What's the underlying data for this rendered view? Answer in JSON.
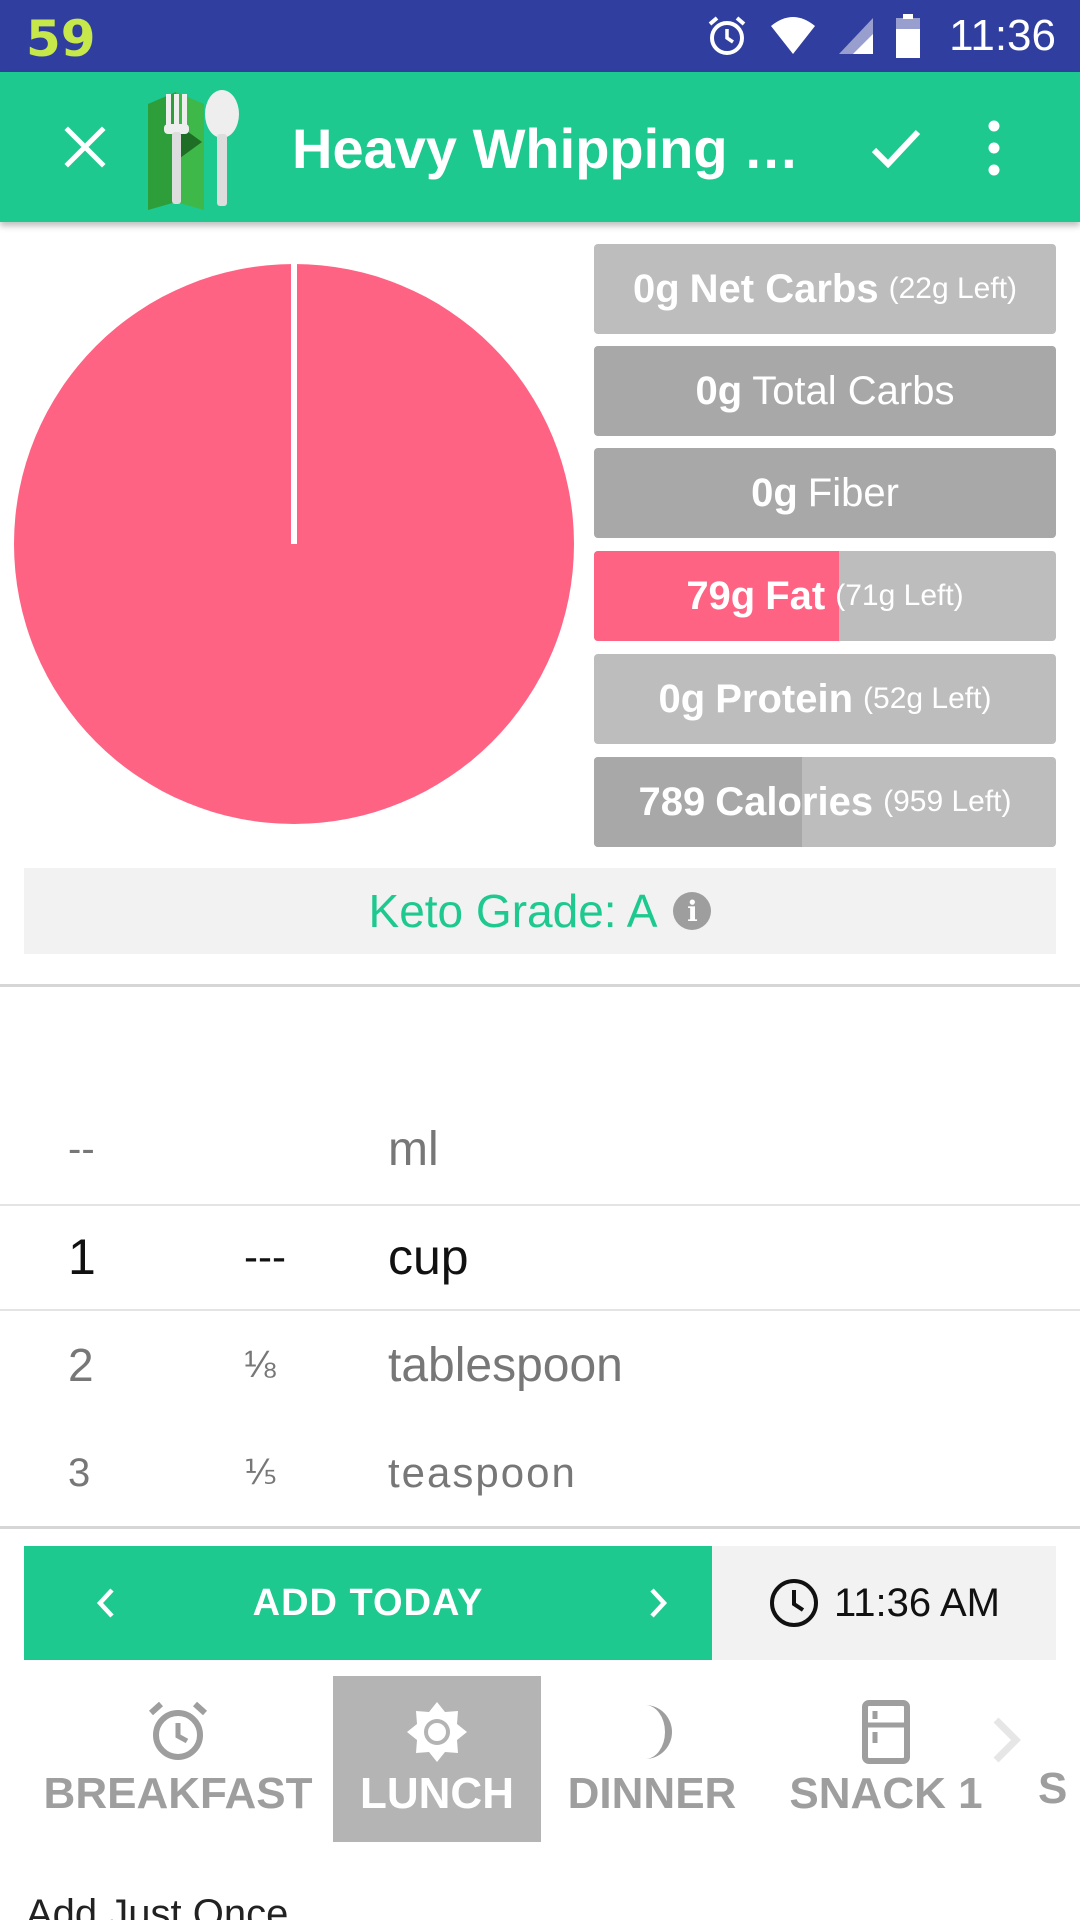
{
  "status_bar": {
    "notification_number": "59",
    "time": "11:36",
    "icons": [
      "alarm-icon",
      "wifi-icon",
      "signal-icon",
      "battery-icon"
    ]
  },
  "toolbar": {
    "title": "Heavy Whipping Cr...",
    "close_icon": "close-icon",
    "confirm_icon": "check-icon",
    "more_icon": "more-vert-icon",
    "logo_icon": "fork-spoon-logo-icon"
  },
  "pie": {
    "fat_fraction": 1.0,
    "fat_color": "#FF6384"
  },
  "macros": {
    "net_carbs": {
      "value": "0g",
      "label": "Net Carbs",
      "left": "(22g Left)",
      "fill_fraction": 0.0
    },
    "total_carbs": {
      "value": "0g",
      "label": "Total Carbs"
    },
    "fiber": {
      "value": "0g",
      "label": "Fiber"
    },
    "fat": {
      "value": "79g",
      "label": "Fat",
      "left": "(71g Left)",
      "fill_fraction": 0.53,
      "fill_color": "#FF6384"
    },
    "protein": {
      "value": "0g",
      "label": "Protein",
      "left": "(52g Left)",
      "fill_fraction": 0.0
    },
    "calories": {
      "value": "789",
      "label": "Calories",
      "left": "(959 Left)",
      "fill_fraction": 0.45,
      "fill_color": "#A8A8A8"
    }
  },
  "keto_grade": {
    "label": "Keto Grade: A",
    "info_glyph": "i"
  },
  "picker": {
    "rows": [
      {
        "whole": "--",
        "fraction": "",
        "unit": "ml"
      },
      {
        "whole": "1",
        "fraction": "---",
        "unit": "cup"
      },
      {
        "whole": "2",
        "fraction": "⅛",
        "unit": "tablespoon"
      },
      {
        "whole": "3",
        "fraction": "⅕",
        "unit": "teaspoon"
      }
    ]
  },
  "add": {
    "label": "ADD TODAY",
    "time": "11:36 AM"
  },
  "meals": [
    {
      "label": "BREAKFAST",
      "icon": "alarm-clock-icon",
      "active": false
    },
    {
      "label": "LUNCH",
      "icon": "sun-icon",
      "active": true
    },
    {
      "label": "DINNER",
      "icon": "moon-icon",
      "active": false
    },
    {
      "label": "SNACK 1",
      "icon": "fridge-icon",
      "active": false
    },
    {
      "label": "S",
      "icon": "",
      "active": false
    }
  ],
  "footer": {
    "text": "Add Just Once"
  },
  "colors": {
    "accent": "#1DC98E",
    "status_bar": "#303F9F",
    "fat": "#FF6384",
    "bar_gray": "#BDBDBD"
  }
}
